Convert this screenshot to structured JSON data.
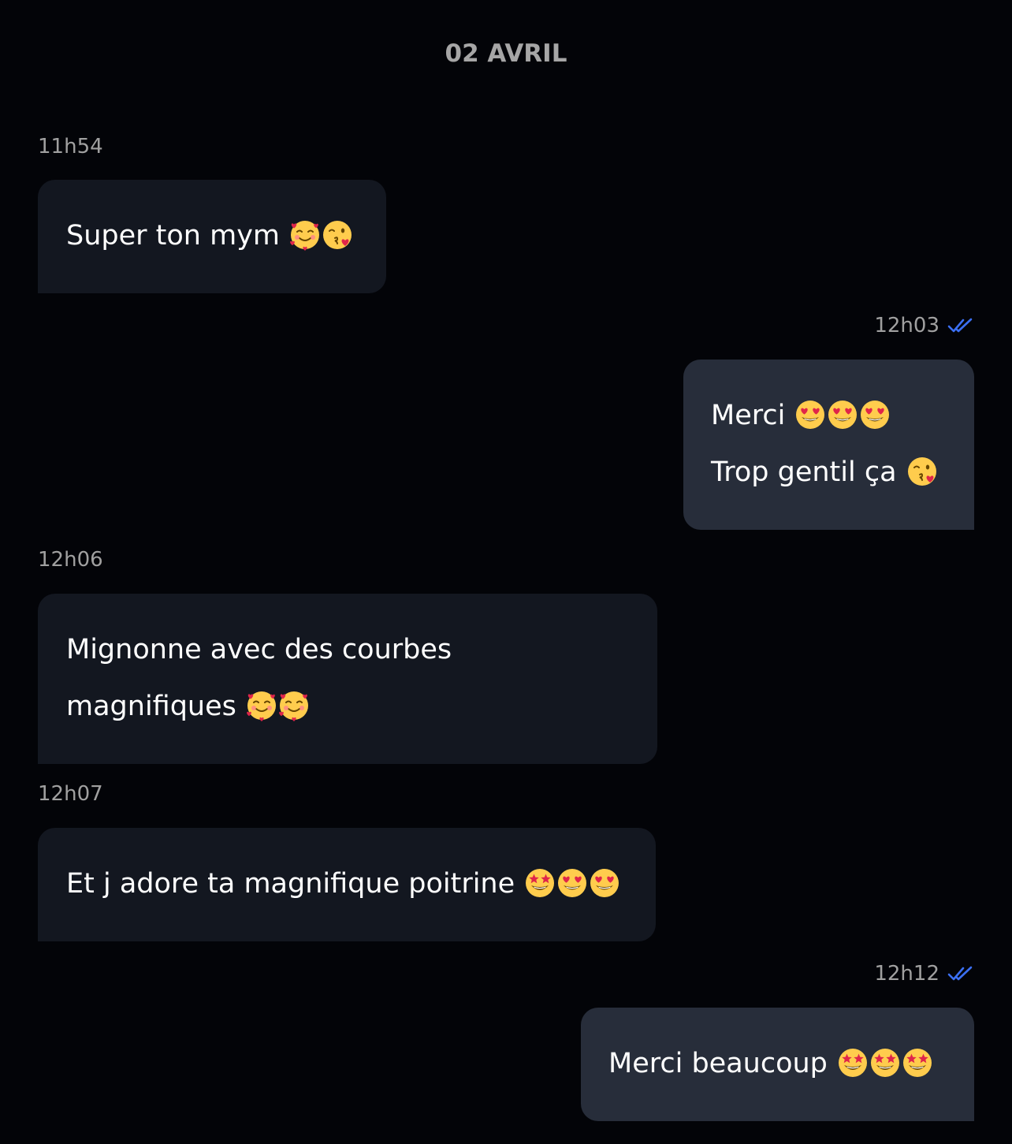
{
  "date_header": "02 AVRIL",
  "messages": [
    {
      "time": "11h54",
      "direction": "in",
      "lines": [
        {
          "text": "Super ton mym",
          "emojis": [
            "smiling-face-with-hearts",
            "face-blowing-kiss"
          ]
        }
      ]
    },
    {
      "time": "12h03",
      "direction": "out",
      "read": true,
      "lines": [
        {
          "text": "Merci",
          "emojis": [
            "heart-eyes",
            "heart-eyes",
            "heart-eyes"
          ]
        },
        {
          "text": "Trop gentil ça",
          "emojis": [
            "face-blowing-kiss"
          ]
        }
      ]
    },
    {
      "time": "12h06",
      "direction": "in",
      "lines": [
        {
          "text": "Mignonne avec des courbes",
          "emojis": []
        },
        {
          "text": "magnifiques",
          "emojis": [
            "smiling-face-with-hearts",
            "smiling-face-with-hearts"
          ]
        }
      ]
    },
    {
      "time": "12h07",
      "direction": "in",
      "lines": [
        {
          "text": "Et j adore ta magnifique poitrine",
          "emojis": [
            "star-struck",
            "heart-eyes",
            "heart-eyes"
          ]
        }
      ]
    },
    {
      "time": "12h12",
      "direction": "out",
      "read": true,
      "lines": [
        {
          "text": "Merci beaucoup",
          "emojis": [
            "star-struck",
            "star-struck",
            "star-struck"
          ]
        }
      ]
    }
  ],
  "colors": {
    "background": "#030408",
    "bubble_in": "#131720",
    "bubble_out": "#272d3a",
    "read_check": "#3b6ff2",
    "timestamp": "#a0a0a0"
  }
}
